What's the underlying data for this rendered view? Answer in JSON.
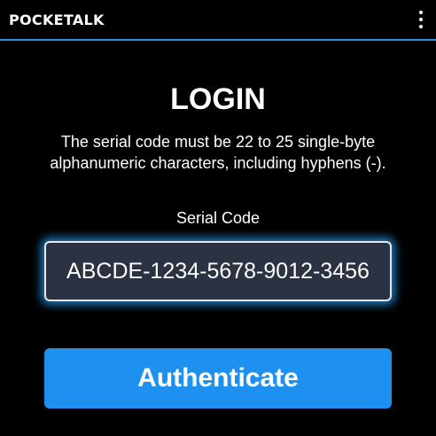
{
  "header": {
    "logo_text": "POCKETALK",
    "menu_icon": "more-vertical-icon",
    "accent_color": "#2a8bd8"
  },
  "login": {
    "title": "LOGIN",
    "description": "The serial code must be 22 to 25 single-byte alphanumeric characters, including hyphens (-).",
    "serial_label": "Serial Code",
    "serial_value": "ABCDE-1234-5678-9012-3456",
    "button_label": "Authenticate",
    "button_color": "#1e90f0"
  }
}
